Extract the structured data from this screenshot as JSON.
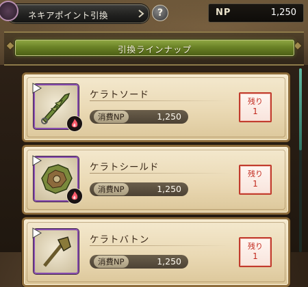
{
  "header": {
    "title": "ネキアポイント引換",
    "help_label": "?",
    "np_label": "NP",
    "np_value": "1,250"
  },
  "section": {
    "title": "引換ラインナップ"
  },
  "items": [
    {
      "name": "ケラトソード",
      "cost_label": "消費NP",
      "cost_value": "1,250",
      "remain_label": "残り",
      "remain_count": "1"
    },
    {
      "name": "ケラトシールド",
      "cost_label": "消費NP",
      "cost_value": "1,250",
      "remain_label": "残り",
      "remain_count": "1"
    },
    {
      "name": "ケラトバトン",
      "cost_label": "消費NP",
      "cost_value": "1,250",
      "remain_label": "残り",
      "remain_count": "1"
    }
  ],
  "icons": {
    "help": "question-icon",
    "title_arrow": "chevron-right-icon",
    "element": "fire-element-icon",
    "play": "play-flag-icon"
  },
  "colors": {
    "section_green": "#6a8126",
    "remain_red": "#c13b2d",
    "rarity_purple": "#8a4fb0",
    "card_parchment": "#ead9b4"
  }
}
